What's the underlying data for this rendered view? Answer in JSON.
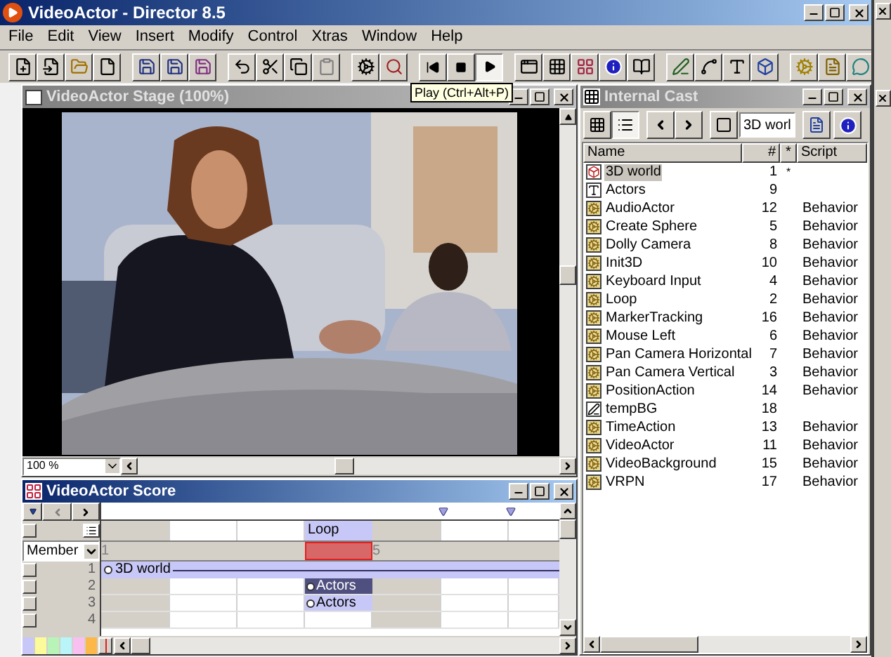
{
  "window": {
    "title": "VideoActor - Director 8.5"
  },
  "menu": [
    "File",
    "Edit",
    "View",
    "Insert",
    "Modify",
    "Control",
    "Xtras",
    "Window",
    "Help"
  ],
  "transport": [
    {
      "selected": false
    },
    {
      "selected": false
    },
    {
      "selected": true
    }
  ],
  "tooltip": "Play (Ctrl+Alt+P)",
  "stage": {
    "title": "VideoActor Stage (100%)",
    "zoom": "100 %"
  },
  "cast": {
    "title": "Internal Cast",
    "search": "3D worl",
    "columns": [
      "Name",
      "#",
      "*",
      "Script"
    ],
    "rows": [
      {
        "kind": "model",
        "name": "3D world",
        "number": "1",
        "flag": "*",
        "script": "",
        "selected": true
      },
      {
        "kind": "text",
        "name": "Actors",
        "number": "9",
        "flag": "",
        "script": "",
        "selected": false
      },
      {
        "kind": "behavior",
        "name": "AudioActor",
        "number": "12",
        "flag": "",
        "script": "Behavior",
        "selected": false
      },
      {
        "kind": "behavior",
        "name": "Create Sphere",
        "number": "5",
        "flag": "",
        "script": "Behavior",
        "selected": false
      },
      {
        "kind": "behavior",
        "name": "Dolly Camera",
        "number": "8",
        "flag": "",
        "script": "Behavior",
        "selected": false
      },
      {
        "kind": "behavior",
        "name": "Init3D",
        "number": "10",
        "flag": "",
        "script": "Behavior",
        "selected": false
      },
      {
        "kind": "behavior",
        "name": "Keyboard Input",
        "number": "4",
        "flag": "",
        "script": "Behavior",
        "selected": false
      },
      {
        "kind": "behavior",
        "name": "Loop",
        "number": "2",
        "flag": "",
        "script": "Behavior",
        "selected": false
      },
      {
        "kind": "behavior",
        "name": "MarkerTracking",
        "number": "16",
        "flag": "",
        "script": "Behavior",
        "selected": false
      },
      {
        "kind": "behavior",
        "name": "Mouse Left",
        "number": "6",
        "flag": "",
        "script": "Behavior",
        "selected": false
      },
      {
        "kind": "behavior",
        "name": "Pan Camera Horizontal",
        "number": "7",
        "flag": "",
        "script": "Behavior",
        "selected": false
      },
      {
        "kind": "behavior",
        "name": "Pan Camera Vertical",
        "number": "3",
        "flag": "",
        "script": "Behavior",
        "selected": false
      },
      {
        "kind": "behavior",
        "name": "PositionAction",
        "number": "14",
        "flag": "",
        "script": "Behavior",
        "selected": false
      },
      {
        "kind": "vector",
        "name": "tempBG",
        "number": "18",
        "flag": "",
        "script": "",
        "selected": false
      },
      {
        "kind": "behavior",
        "name": "TimeAction",
        "number": "13",
        "flag": "",
        "script": "Behavior",
        "selected": false
      },
      {
        "kind": "behavior",
        "name": "VideoActor",
        "number": "11",
        "flag": "",
        "script": "Behavior",
        "selected": false
      },
      {
        "kind": "behavior",
        "name": "VideoBackground",
        "number": "15",
        "flag": "",
        "script": "Behavior",
        "selected": false
      },
      {
        "kind": "behavior",
        "name": "VRPN",
        "number": "17",
        "flag": "",
        "script": "Behavior",
        "selected": false
      }
    ]
  },
  "score": {
    "title": "VideoActor Score",
    "label": "Loop",
    "member": "Member",
    "frame_numbers": [
      "1",
      "5"
    ],
    "channels": [
      {
        "number": "1",
        "sprite": {
          "name": "3D world",
          "full_span": true,
          "selected": false
        }
      },
      {
        "number": "2",
        "sprite": {
          "name": "Actors",
          "full_span": false,
          "selected": true
        }
      },
      {
        "number": "3",
        "sprite": {
          "name": "Actors",
          "full_span": false,
          "selected": false
        }
      },
      {
        "number": "4"
      }
    ],
    "sprite_colors": [
      {
        "color": "#c8c8f8"
      },
      {
        "color": "#fbfb9c"
      },
      {
        "color": "#b8f4b8"
      },
      {
        "color": "#b8f4f8"
      },
      {
        "color": "#f8c0f0"
      },
      {
        "color": "#fcb848"
      }
    ]
  }
}
